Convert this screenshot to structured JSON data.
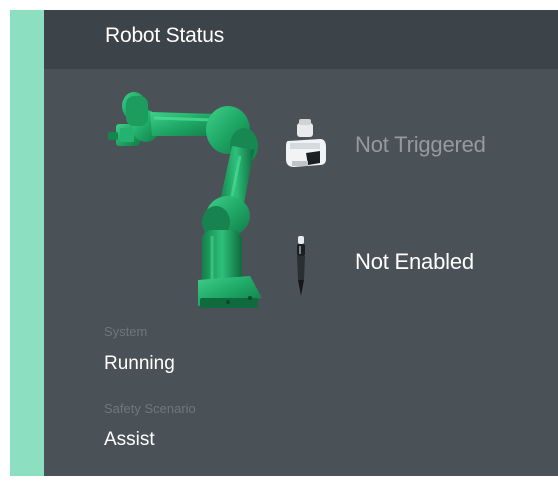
{
  "panel": {
    "title": "Robot Status"
  },
  "status": {
    "tcp_sensor": {
      "icon": "tcp-sensor-icon",
      "text": "Not Triggered"
    },
    "tool": {
      "icon": "tool-pen-icon",
      "text": "Not Enabled"
    }
  },
  "fields": {
    "system": {
      "label": "System",
      "value": "Running"
    },
    "safety_scenario": {
      "label": "Safety Scenario",
      "value": "Assist"
    }
  },
  "colors": {
    "accent": "#8ddfc1",
    "panel_bg": "#4a5257",
    "header_bg": "#3d4449",
    "robot_green": "#1fa866",
    "muted_text": "#949a9e",
    "label_text": "#6f777b"
  }
}
